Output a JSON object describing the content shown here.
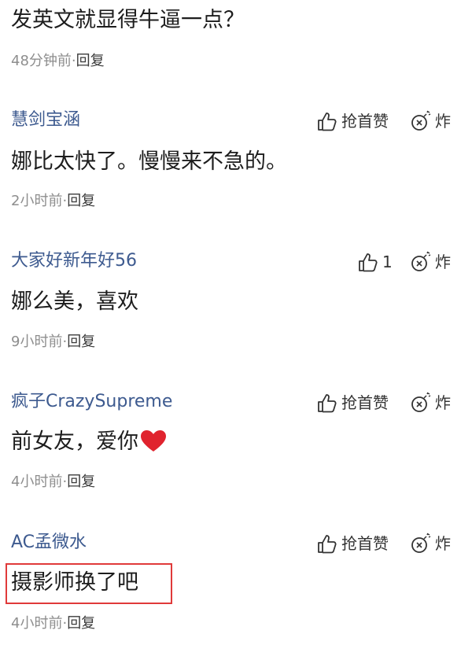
{
  "top": {
    "text": "发英文就显得牛逼一点？",
    "time": "48分钟前",
    "dot": "·",
    "reply": "回复"
  },
  "comments": [
    {
      "username": "慧剑宝涵",
      "like_label": "抢首赞",
      "bomb_label": "炸",
      "content": "娜比太快了。慢慢来不急的。",
      "time": "2小时前",
      "dot": "·",
      "reply": "回复"
    },
    {
      "username": "大家好新年好56",
      "like_label": "1",
      "bomb_label": "炸",
      "content": "娜么美，喜欢",
      "time": "9小时前",
      "dot": "·",
      "reply": "回复"
    },
    {
      "username": "疯子CrazySupreme",
      "like_label": "抢首赞",
      "bomb_label": "炸",
      "content": "前女友，爱你",
      "content_emoji": "red-heart",
      "time": "4小时前",
      "dot": "·",
      "reply": "回复"
    },
    {
      "username": "AC孟微水",
      "like_label": "抢首赞",
      "bomb_label": "炸",
      "content": "摄影师换了吧",
      "highlighted": true,
      "time": "4小时前",
      "dot": "·",
      "reply": "回复"
    }
  ],
  "icons": {
    "like": "thumbs-up-icon",
    "bomb": "bomb-icon",
    "heart": "heart-icon"
  },
  "colors": {
    "username": "#3d5a8f",
    "meta": "#8e8e8e",
    "highlight": "#e03a3a",
    "heart": "#e0232e"
  }
}
